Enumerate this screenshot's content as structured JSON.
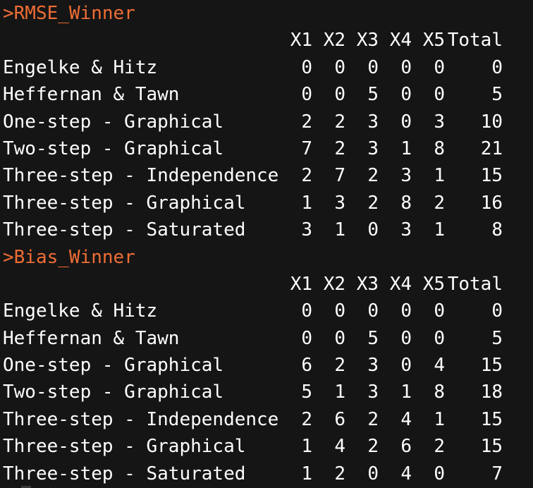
{
  "console": {
    "prompt": ">",
    "blocks": [
      {
        "command": "RMSE_Winner",
        "columns": [
          "X1",
          "X2",
          "X3",
          "X4",
          "X5",
          "Total"
        ],
        "rows": [
          {
            "label": "Engelke & Hitz",
            "values": [
              "0",
              "0",
              "0",
              "0",
              "0",
              "0"
            ]
          },
          {
            "label": "Heffernan & Tawn",
            "values": [
              "0",
              "0",
              "5",
              "0",
              "0",
              "5"
            ]
          },
          {
            "label": "One-step - Graphical",
            "values": [
              "2",
              "2",
              "3",
              "0",
              "3",
              "10"
            ]
          },
          {
            "label": "Two-step - Graphical",
            "values": [
              "7",
              "2",
              "3",
              "1",
              "8",
              "21"
            ]
          },
          {
            "label": "Three-step - Independence",
            "values": [
              "2",
              "7",
              "2",
              "3",
              "1",
              "15"
            ]
          },
          {
            "label": "Three-step - Graphical",
            "values": [
              "1",
              "3",
              "2",
              "8",
              "2",
              "16"
            ]
          },
          {
            "label": "Three-step - Saturated",
            "values": [
              "3",
              "1",
              "0",
              "3",
              "1",
              "8"
            ]
          }
        ]
      },
      {
        "command": "Bias_Winner",
        "columns": [
          "X1",
          "X2",
          "X3",
          "X4",
          "X5",
          "Total"
        ],
        "rows": [
          {
            "label": "Engelke & Hitz",
            "values": [
              "0",
              "0",
              "0",
              "0",
              "0",
              "0"
            ]
          },
          {
            "label": "Heffernan & Tawn",
            "values": [
              "0",
              "0",
              "5",
              "0",
              "0",
              "5"
            ]
          },
          {
            "label": "One-step - Graphical",
            "values": [
              "6",
              "2",
              "3",
              "0",
              "4",
              "15"
            ]
          },
          {
            "label": "Two-step - Graphical",
            "values": [
              "5",
              "1",
              "3",
              "1",
              "8",
              "18"
            ]
          },
          {
            "label": "Three-step - Independence",
            "values": [
              "2",
              "6",
              "2",
              "4",
              "1",
              "15"
            ]
          },
          {
            "label": "Three-step - Graphical",
            "values": [
              "1",
              "4",
              "2",
              "6",
              "2",
              "15"
            ]
          },
          {
            "label": "Three-step - Saturated",
            "values": [
              "1",
              "2",
              "0",
              "4",
              "0",
              "7"
            ]
          }
        ]
      }
    ]
  },
  "colors": {
    "background": "#151515",
    "text": "#ffffff",
    "command": "#ef6d35"
  }
}
